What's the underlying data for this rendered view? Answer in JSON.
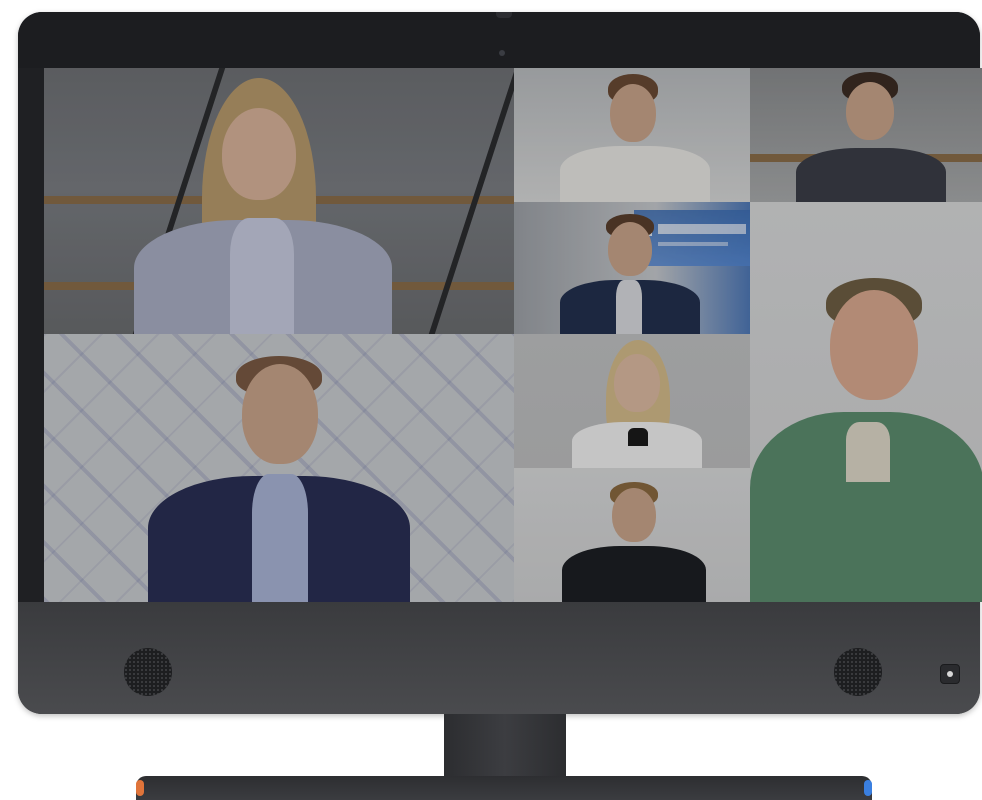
{
  "app": {
    "title": ""
  },
  "video_call": {
    "participants": [
      {
        "id": "p1",
        "tile": "top-left-large"
      },
      {
        "id": "p2",
        "tile": "top-middle"
      },
      {
        "id": "p3",
        "tile": "top-right"
      },
      {
        "id": "p4",
        "tile": "middle-upper"
      },
      {
        "id": "p5",
        "tile": "bottom-left-large"
      },
      {
        "id": "p6",
        "tile": "middle-center"
      },
      {
        "id": "p7",
        "tile": "bottom-middle"
      },
      {
        "id": "p8",
        "tile": "right-large"
      }
    ],
    "background_branding_icon": "tv-logo-icon"
  },
  "colors": {
    "bezel": "#1f2023",
    "chin": "#4a4b4e",
    "accent_left": "#e0743a",
    "accent_right": "#3a7fe0",
    "brand_blue": "#3e6fb5"
  },
  "icons": {
    "camera": "camera-icon",
    "speaker_left": "speaker-icon",
    "speaker_right": "speaker-icon",
    "power": "power-icon"
  }
}
